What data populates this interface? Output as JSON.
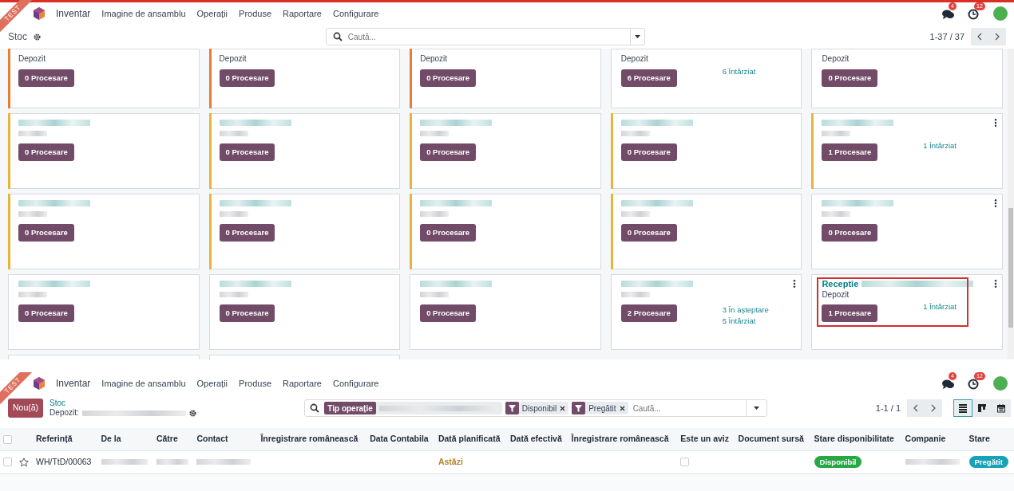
{
  "kanban_screen": {
    "ribbon": "TEST",
    "navbar": {
      "app": "Inventar",
      "menu": [
        "Imagine de ansamblu",
        "Operații",
        "Produse",
        "Raportare",
        "Configurare"
      ],
      "messages_count": "4",
      "activities_count": "12"
    },
    "breadcrumb": "Stoc",
    "search": {
      "placeholder": "Caută..."
    },
    "pager": "1-37 / 37",
    "cards": [
      {
        "kind": "partial",
        "subtitle": "Depozit",
        "button": "0 Procesare",
        "color": "#e07f35",
        "selected": false
      },
      {
        "kind": "partial",
        "subtitle": "Depozit",
        "button": "0 Procesare",
        "color": "#e07f35",
        "selected": false
      },
      {
        "kind": "partial",
        "subtitle": "Depozit",
        "button": "0 Procesare",
        "color": "#e07f35",
        "selected": false
      },
      {
        "kind": "partial",
        "subtitle": "Depozit",
        "button": "6 Procesare",
        "stats": [
          "6 Întârziat"
        ],
        "selected": false
      },
      {
        "kind": "partial",
        "subtitle": "Depozit",
        "button": "0 Procesare",
        "selected": false
      },
      {
        "kind": "full",
        "button": "0 Procesare",
        "color": "#e6b53a",
        "selected": false
      },
      {
        "kind": "full",
        "button": "0 Procesare",
        "color": "#e6b53a",
        "selected": false
      },
      {
        "kind": "full",
        "button": "0 Procesare",
        "color": "#e6b53a",
        "selected": false
      },
      {
        "kind": "full",
        "button": "0 Procesare",
        "color": "#e6b53a",
        "selected": false
      },
      {
        "kind": "full",
        "button": "1 Procesare",
        "stats": [
          "1 Întârziat"
        ],
        "color": "#e6b53a",
        "menu": true,
        "selected": false
      },
      {
        "kind": "full",
        "button": "0 Procesare",
        "color": "#e6b53a",
        "selected": false
      },
      {
        "kind": "full",
        "button": "0 Procesare",
        "color": "#e6b53a",
        "selected": false
      },
      {
        "kind": "full",
        "button": "0 Procesare",
        "color": "#e6b53a",
        "selected": false
      },
      {
        "kind": "full",
        "button": "0 Procesare",
        "color": "#e6b53a",
        "selected": false
      },
      {
        "kind": "full",
        "button": "0 Procesare",
        "menu": true,
        "selected": false
      },
      {
        "kind": "full",
        "button": "0 Procesare",
        "selected": false
      },
      {
        "kind": "full",
        "button": "0 Procesare",
        "selected": false
      },
      {
        "kind": "full",
        "button": "0 Procesare",
        "selected": false
      },
      {
        "kind": "full",
        "button": "2 Procesare",
        "stats": [
          "3 În așteptare",
          "5 Întârziat"
        ],
        "menu": true,
        "selected": false
      },
      {
        "kind": "full",
        "title": "Receptie",
        "subtitle": "Depozit",
        "button": "1 Procesare",
        "stats": [
          "1 Întârziat"
        ],
        "menu": true,
        "selected": true
      },
      {
        "kind": "sliver"
      },
      {
        "kind": "sliver"
      }
    ]
  },
  "list_screen": {
    "ribbon": "TEST",
    "navbar": {
      "app": "Inventar",
      "menu": [
        "Imagine de ansamblu",
        "Operații",
        "Produse",
        "Raportare",
        "Configurare"
      ],
      "messages_count": "4",
      "activities_count": "12"
    },
    "new_button": "Nou(ă)",
    "breadcrumb": "Stoc",
    "record_label": "Depozit:",
    "search": {
      "facets": [
        {
          "kind": "field",
          "label": "Tip operație"
        },
        {
          "kind": "filter",
          "label": "Disponibil"
        },
        {
          "kind": "filter",
          "label": "Pregătit"
        }
      ],
      "placeholder": "Caută..."
    },
    "pager": "1-1 / 1",
    "views": [
      {
        "kind": "list",
        "selected": true
      },
      {
        "kind": "kanban",
        "selected": false
      },
      {
        "kind": "calendar",
        "selected": false
      }
    ],
    "table": {
      "columns": [
        "Referință",
        "De la",
        "Către",
        "Contact",
        "Înregistrare românească",
        "Data Contabila",
        "Dată planificată",
        "Dată efectivă",
        "Înregistrare românească",
        "Este un aviz",
        "Document sursă",
        "Stare disponibilitate",
        "Companie",
        "Stare"
      ],
      "all_selected": false,
      "rows": [
        {
          "checked": false,
          "starred": false,
          "cells": [
            {
              "kind": "text",
              "text": "WH/TtD/00063"
            },
            {
              "kind": "blurred"
            },
            {
              "kind": "blurred"
            },
            {
              "kind": "blurred"
            },
            {
              "kind": "empty"
            },
            {
              "kind": "empty"
            },
            {
              "kind": "date",
              "text": "Astăzi"
            },
            {
              "kind": "empty"
            },
            {
              "kind": "empty"
            },
            {
              "kind": "checkbox",
              "checked": false
            },
            {
              "kind": "empty"
            },
            {
              "kind": "badge",
              "text": "Disponibil",
              "color": "#28a745"
            },
            {
              "kind": "blurred"
            },
            {
              "kind": "badge",
              "text": "Pregătit",
              "color": "#17a2b8"
            }
          ]
        }
      ]
    }
  }
}
